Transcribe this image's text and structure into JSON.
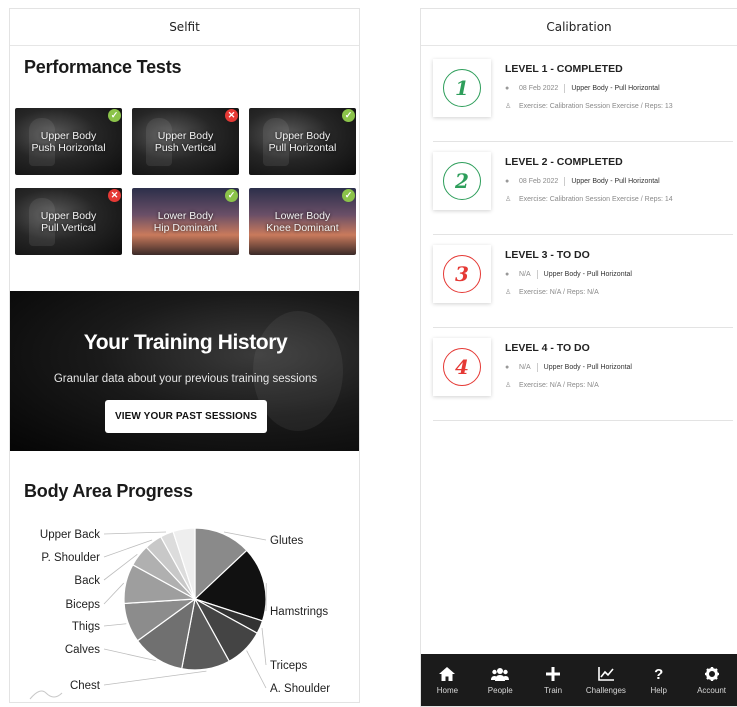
{
  "left": {
    "title": "Selfit",
    "performance_title": "Performance Tests",
    "tiles": [
      {
        "label_1": "Upper Body",
        "label_2": "Push Horizontal",
        "status": "done",
        "status_icon": "check-icon"
      },
      {
        "label_1": "Upper Body",
        "label_2": "Push Vertical",
        "status": "fail",
        "status_icon": "close-icon"
      },
      {
        "label_1": "Upper Body",
        "label_2": "Pull Horizontal",
        "status": "done",
        "status_icon": "check-icon"
      },
      {
        "label_1": "Upper Body",
        "label_2": "Pull Vertical",
        "status": "fail",
        "status_icon": "close-icon"
      },
      {
        "label_1": "Lower Body",
        "label_2": "Hip Dominant",
        "status": "done",
        "status_icon": "check-icon"
      },
      {
        "label_1": "Lower Body",
        "label_2": "Knee Dominant",
        "status": "done",
        "status_icon": "check-icon"
      }
    ],
    "history": {
      "title": "Your Training History",
      "subtitle": "Granular data about your previous training sessions",
      "button": "VIEW YOUR PAST SESSIONS"
    },
    "body_area_title": "Body Area Progress"
  },
  "chart_data": {
    "type": "pie",
    "title": "Body Area Progress",
    "slices": [
      {
        "label": "Glutes",
        "value": 13,
        "color": "#8a8a8a"
      },
      {
        "label": "Hamstrings",
        "value": 17,
        "color": "#111111"
      },
      {
        "label": "Triceps",
        "value": 3,
        "color": "#333333"
      },
      {
        "label": "A. Shoulder",
        "value": 9,
        "color": "#444444"
      },
      {
        "label": "Chest",
        "value": 11,
        "color": "#5a5a5a"
      },
      {
        "label": "Calves",
        "value": 12,
        "color": "#707070"
      },
      {
        "label": "Thigs",
        "value": 9,
        "color": "#8c8c8c"
      },
      {
        "label": "Biceps",
        "value": 9,
        "color": "#9e9e9e"
      },
      {
        "label": "Back",
        "value": 5,
        "color": "#b0b0b0"
      },
      {
        "label": "P. Shoulder",
        "value": 4,
        "color": "#c8c8c8"
      },
      {
        "label": "Upper Back",
        "value": 3,
        "color": "#dcdcdc"
      },
      {
        "label": "",
        "value": 5,
        "color": "#eeeeee"
      }
    ]
  },
  "right": {
    "title": "Calibration",
    "levels": [
      {
        "title": "LEVEL 1 - COMPLETED",
        "number": "1",
        "color": "#2e9e5b",
        "date": "08 Feb 2022",
        "exercise_type": "Upper Body - Pull Horizontal",
        "detail": "Exercise: Calibration Session Exercise / Reps: 13"
      },
      {
        "title": "LEVEL 2 - COMPLETED",
        "number": "2",
        "color": "#2e9e5b",
        "date": "08 Feb 2022",
        "exercise_type": "Upper Body - Pull Horizontal",
        "detail": "Exercise: Calibration Session Exercise / Reps: 14"
      },
      {
        "title": "LEVEL 3 - TO DO",
        "number": "3",
        "color": "#e53935",
        "date": "N/A",
        "exercise_type": "Upper Body - Pull Horizontal",
        "detail": "Exercise: N/A / Reps: N/A"
      },
      {
        "title": "LEVEL 4 - TO DO",
        "number": "4",
        "color": "#e53935",
        "date": "N/A",
        "exercise_type": "Upper Body - Pull Horizontal",
        "detail": "Exercise: N/A / Reps: N/A"
      }
    ],
    "nav": [
      {
        "label": "Home",
        "icon": "home-icon"
      },
      {
        "label": "People",
        "icon": "people-icon"
      },
      {
        "label": "Train",
        "icon": "plus-icon"
      },
      {
        "label": "Challenges",
        "icon": "chart-icon"
      },
      {
        "label": "Help",
        "icon": "help-icon"
      },
      {
        "label": "Account",
        "icon": "gear-icon"
      }
    ]
  }
}
